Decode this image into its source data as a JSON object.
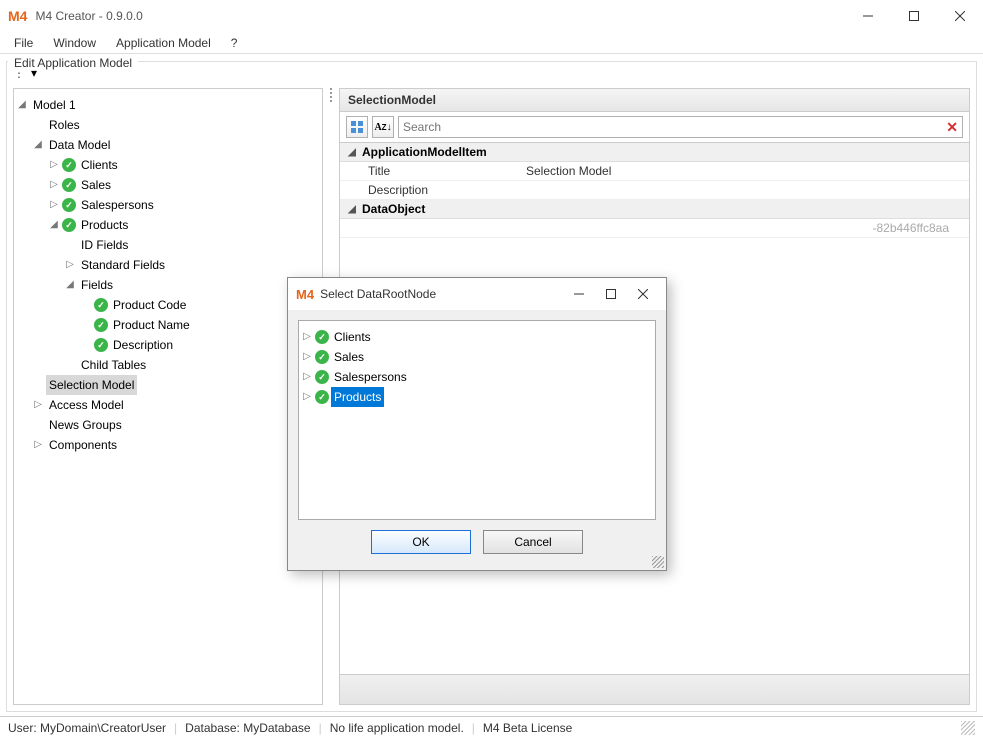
{
  "window": {
    "title": "M4 Creator - 0.9.0.0",
    "logo_text": "M4"
  },
  "menubar": {
    "file": "File",
    "window": "Window",
    "app_model": "Application Model",
    "help": "?"
  },
  "group_label": "Edit Application Model",
  "left_tree": {
    "root": "Model 1",
    "roles": "Roles",
    "data_model": "Data Model",
    "clients": "Clients",
    "sales": "Sales",
    "salespersons": "Salespersons",
    "products": "Products",
    "id_fields": "ID Fields",
    "standard_fields": "Standard Fields",
    "fields": "Fields",
    "product_code": "Product Code",
    "product_name": "Product Name",
    "description": "Description",
    "child_tables": "Child Tables",
    "selection_model": "Selection Model",
    "access_model": "Access Model",
    "news_groups": "News Groups",
    "components": "Components"
  },
  "right_panel": {
    "header": "SelectionModel",
    "search_placeholder": "Search",
    "cat_app_item": "ApplicationModelItem",
    "prop_title_name": "Title",
    "prop_title_value": "Selection Model",
    "prop_desc_name": "Description",
    "cat_data_object": "DataObject",
    "guid_fragment": "-82b446ffc8aa"
  },
  "dialog": {
    "logo_text": "M4",
    "title": "Select DataRootNode",
    "items": {
      "clients": "Clients",
      "sales": "Sales",
      "salespersons": "Salespersons",
      "products": "Products"
    },
    "ok": "OK",
    "cancel": "Cancel"
  },
  "statusbar": {
    "user": "User: MyDomain\\CreatorUser",
    "database": "Database: MyDatabase",
    "life": "No life application model.",
    "license": "M4 Beta License"
  }
}
